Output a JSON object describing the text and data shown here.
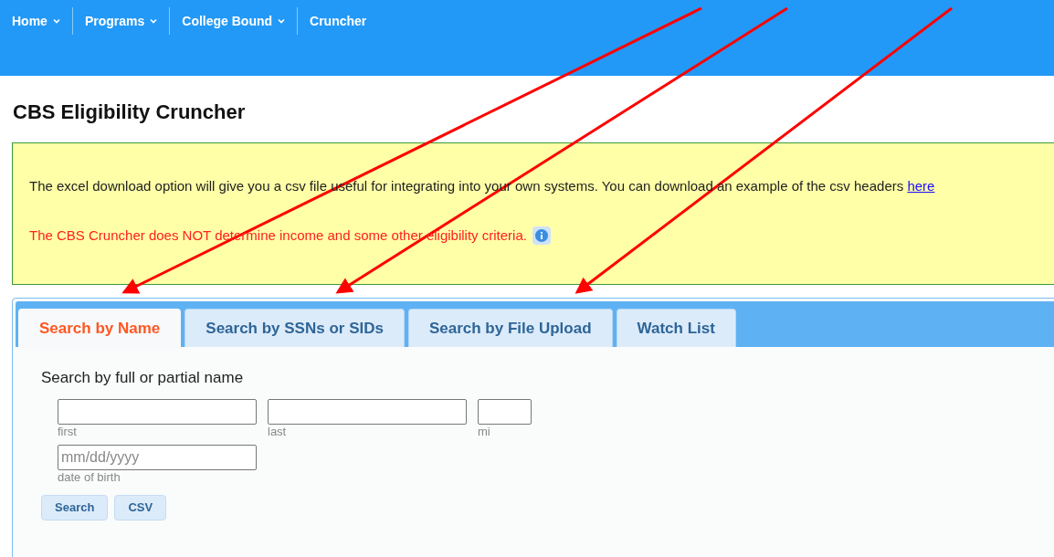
{
  "nav": [
    {
      "label": "Home",
      "dropdown": true
    },
    {
      "label": "Programs",
      "dropdown": true
    },
    {
      "label": "College Bound",
      "dropdown": true
    },
    {
      "label": "Cruncher",
      "dropdown": false
    }
  ],
  "title": "CBS Eligibility Cruncher",
  "notice": {
    "text": "The excel download option will give you a csv file useful for integrating into your own systems. You can download an example of the csv headers",
    "link": "here",
    "warning": "The CBS Cruncher does NOT determine income and some other eligibility criteria."
  },
  "tabs": [
    {
      "label": "Search by Name",
      "selected": true
    },
    {
      "label": "Search by SSNs or SIDs",
      "selected": false
    },
    {
      "label": "Search by File Upload",
      "selected": false
    },
    {
      "label": "Watch List",
      "selected": false
    }
  ],
  "form": {
    "heading": "Search by full or partial name",
    "name_fields": [
      {
        "label": "first",
        "kind": "name"
      },
      {
        "label": "last",
        "kind": "name"
      },
      {
        "label": "mi",
        "kind": "initial"
      }
    ],
    "dob": {
      "placeholder": "mm/dd/yyyy",
      "label": "date of birth"
    },
    "buttons": [
      "Search",
      "CSV"
    ]
  }
}
